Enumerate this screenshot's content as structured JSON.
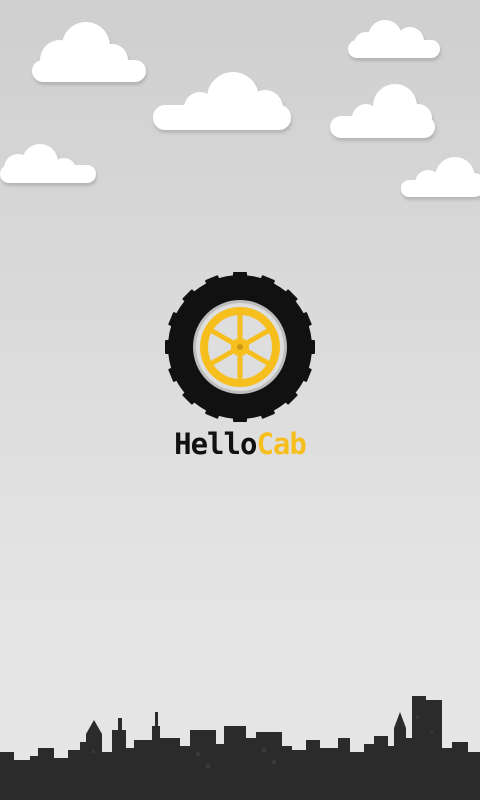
{
  "app": {
    "brand_part1": "Hello",
    "brand_part2": "Cab",
    "logo_icon": "wheel-icon"
  },
  "colors": {
    "tire": "#111111",
    "rim": "#f7bf1e",
    "skyline": "#2b2b2b",
    "cloud": "#ffffff"
  }
}
